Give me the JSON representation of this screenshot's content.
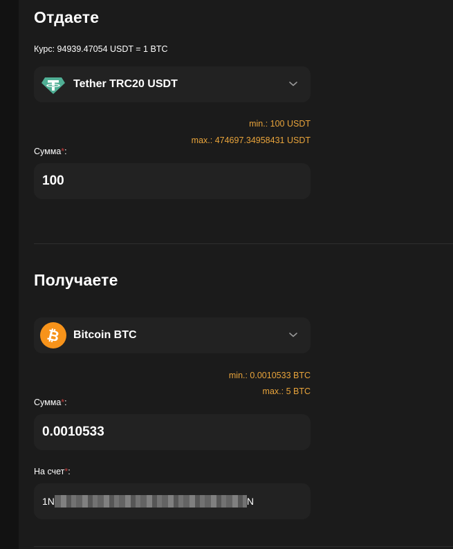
{
  "give": {
    "title": "Отдаете",
    "rate": "Курс: 94939.47054 USDT = 1 BTC",
    "currency": {
      "label": "Tether TRC20 USDT",
      "icon": "tether-icon"
    },
    "min": "min.: 100 USDT",
    "max": "max.: 474697.34958431 USDT",
    "amount_label": "Сумма",
    "required_mark": "*",
    "amount_label_suffix": ":",
    "amount_value": "100"
  },
  "receive": {
    "title": "Получаете",
    "currency": {
      "label": "Bitcoin BTC",
      "icon": "bitcoin-icon"
    },
    "min": "min.: 0.0010533 BTC",
    "max": "max.: 5 BTC",
    "amount_label": "Сумма",
    "required_mark": "*",
    "amount_label_suffix": ":",
    "amount_value": "0.0010533",
    "account_label": "На счет",
    "account_label_suffix": ":",
    "account_prefix": "1N",
    "account_suffix": "N"
  },
  "colors": {
    "accent": "#e9a43b",
    "required": "#c43b3b",
    "tether": "#50af95",
    "bitcoin": "#f7931a",
    "field_bg": "#222222",
    "page_bg": "#1b1b1b"
  }
}
